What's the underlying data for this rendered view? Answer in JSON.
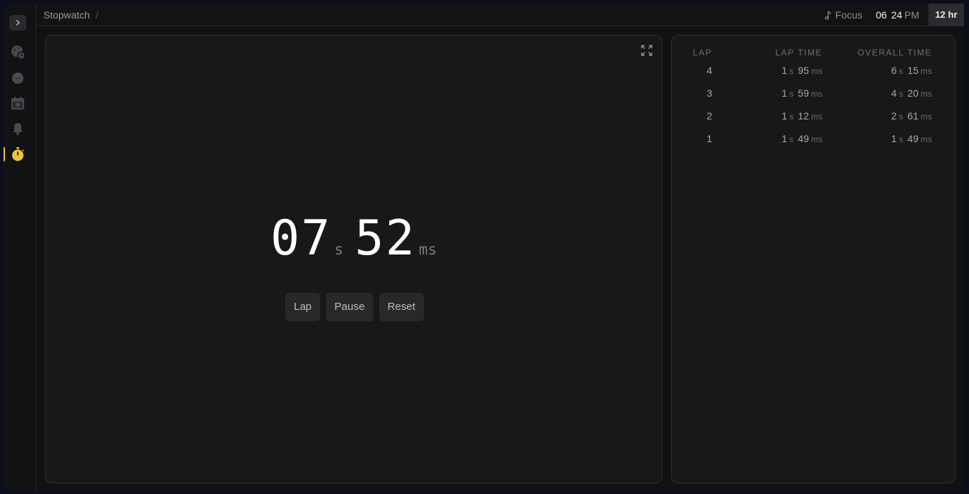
{
  "header": {
    "breadcrumb": "Stopwatch",
    "separator": "/",
    "focus_label": "Focus",
    "clock_hours": "06",
    "clock_minutes": "24",
    "clock_ampm": "PM",
    "format_toggle": "12 hr"
  },
  "sidebar": {
    "items": [
      {
        "icon": "world-clock-icon"
      },
      {
        "icon": "pomodoro-icon"
      },
      {
        "icon": "calendar-icon"
      },
      {
        "icon": "bell-icon"
      },
      {
        "icon": "stopwatch-icon",
        "active": true
      }
    ],
    "accent": "#f0c33c"
  },
  "stopwatch": {
    "seconds": "07",
    "seconds_unit": "s",
    "ms": "52",
    "ms_unit": "ms",
    "buttons": {
      "lap": "Lap",
      "pause": "Pause",
      "reset": "Reset"
    }
  },
  "laps": {
    "headers": {
      "lap": "LAP",
      "lap_time": "LAP TIME",
      "overall_time": "OVERALL TIME"
    },
    "rows": [
      {
        "lap": "4",
        "lap_s": "1",
        "lap_ms": "95",
        "overall_s": "6",
        "overall_ms": "15"
      },
      {
        "lap": "3",
        "lap_s": "1",
        "lap_ms": "59",
        "overall_s": "4",
        "overall_ms": "20"
      },
      {
        "lap": "2",
        "lap_s": "1",
        "lap_ms": "12",
        "overall_s": "2",
        "overall_ms": "61"
      },
      {
        "lap": "1",
        "lap_s": "1",
        "lap_ms": "49",
        "overall_s": "1",
        "overall_ms": "49"
      }
    ],
    "unit_s": "s",
    "unit_ms": "ms"
  }
}
